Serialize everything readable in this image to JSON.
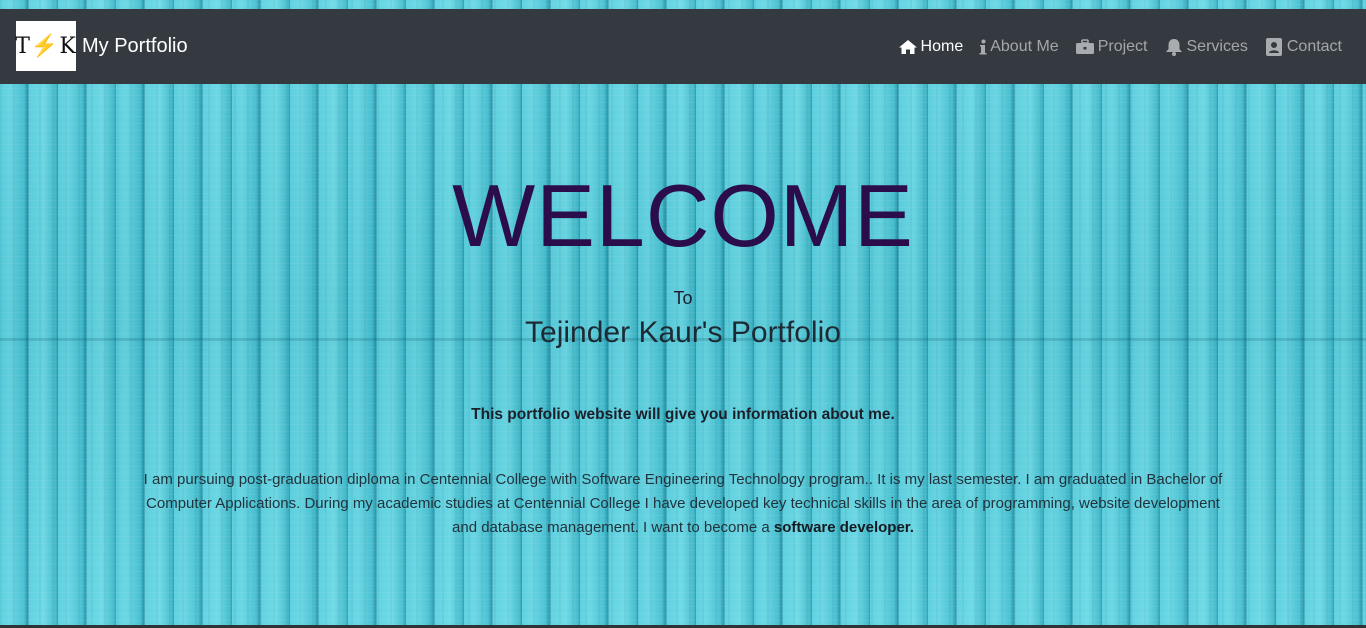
{
  "brand": {
    "logo_left": "T",
    "logo_bolt": "⚡",
    "logo_right": "K",
    "name": "My Portfolio"
  },
  "nav": {
    "items": [
      {
        "label": "Home",
        "icon": "home-icon",
        "active": true
      },
      {
        "label": "About Me",
        "icon": "info-icon",
        "active": false
      },
      {
        "label": "Project",
        "icon": "briefcase-icon",
        "active": false
      },
      {
        "label": "Services",
        "icon": "bell-icon",
        "active": false
      },
      {
        "label": "Contact",
        "icon": "contact-card-icon",
        "active": false
      }
    ]
  },
  "hero": {
    "welcome": "WELCOME",
    "to": "To",
    "title": "Tejinder Kaur's Portfolio",
    "lead": "This portfolio website will give you information about me.",
    "bio_text": "I am pursuing post-graduation diploma in Centennial College with Software Engineering Technology program.. It is my last semester. I am graduated in Bachelor of Computer Applications. During my academic studies at Centennial College I have developed key technical skills in the area of programming, website development and database management. I want to become a",
    "bio_strong": "software developer."
  },
  "colors": {
    "navbar": "#343a40",
    "welcome_text": "#2a0d4a",
    "background": "#4cc6d6"
  }
}
